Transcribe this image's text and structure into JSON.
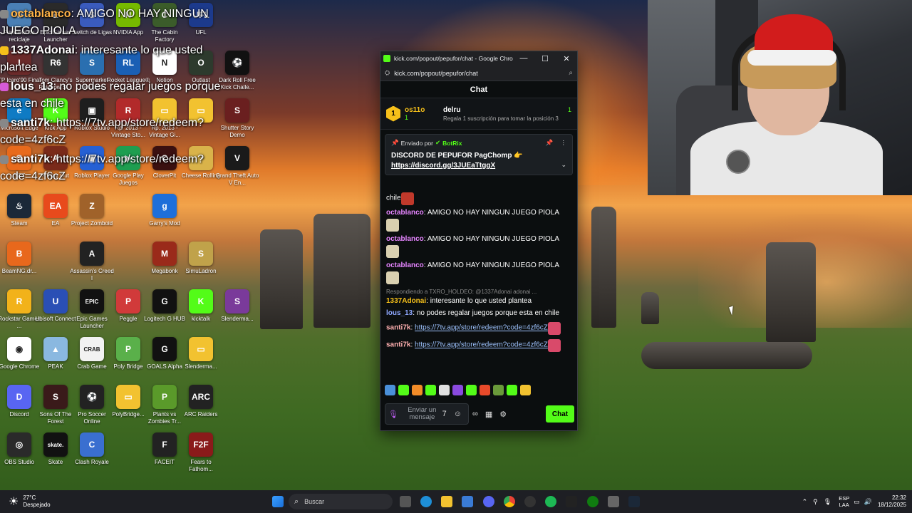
{
  "desktop": {
    "icons": [
      {
        "label": "Papelera de reciclaje",
        "color": "#4a7fb5",
        "glyph": "♻",
        "col": 0,
        "row": 0
      },
      {
        "label": "Epic Games Launcher",
        "color": "#2a2a2a",
        "glyph": "E",
        "col": 1,
        "row": 0
      },
      {
        "label": "Switch de Ligas",
        "color": "#3a5bbd",
        "glyph": "S",
        "col": 2,
        "row": 0
      },
      {
        "label": "NVIDIA App",
        "color": "#76b900",
        "glyph": "N",
        "col": 3,
        "row": 0
      },
      {
        "label": "The Cabin Factory",
        "color": "#3b5c2a",
        "glyph": "C",
        "col": 4,
        "row": 0
      },
      {
        "label": "UFL",
        "color": "#1c3a8c",
        "glyph": "UFL",
        "col": 5,
        "row": 0
      },
      {
        "label": "TP Icaro'90 Final",
        "color": "#6b2a2a",
        "glyph": "I",
        "col": 0,
        "row": 1
      },
      {
        "label": "Tom Clancy's Rainbow Si...",
        "color": "#333",
        "glyph": "R6",
        "col": 1,
        "row": 1
      },
      {
        "label": "Supermarket Simulator",
        "color": "#2a6fb0",
        "glyph": "S",
        "col": 2,
        "row": 1
      },
      {
        "label": "Rocket League®",
        "color": "#1a5fb4",
        "glyph": "RL",
        "col": 3,
        "row": 1
      },
      {
        "label": "Notion",
        "color": "#ffffff",
        "glyph": "N",
        "col": 4,
        "row": 1
      },
      {
        "label": "Outlast",
        "color": "#2d3a2d",
        "glyph": "O",
        "col": 5,
        "row": 1
      },
      {
        "label": "Dark Roll Free Kick Challe...",
        "color": "#111",
        "glyph": "⚽",
        "col": 6,
        "row": 1
      },
      {
        "label": "Microsoft Edge",
        "color": "#0f7bc4",
        "glyph": "e",
        "col": 0,
        "row": 2
      },
      {
        "label": "Kick App",
        "color": "#53fc18",
        "glyph": "K",
        "col": 1,
        "row": 2
      },
      {
        "label": "Roblox Studio",
        "color": "#1e1e1e",
        "glyph": "▣",
        "col": 2,
        "row": 2
      },
      {
        "label": "Rp. 2013 - Vintage Sto...",
        "color": "#b22a2a",
        "glyph": "R",
        "col": 3,
        "row": 2
      },
      {
        "label": "Rp. 2013 - Vintage Gi...",
        "color": "#f2c230",
        "glyph": "▭",
        "col": 4,
        "row": 2
      },
      {
        "label": "",
        "color": "#f2c230",
        "glyph": "▭",
        "col": 5,
        "row": 2
      },
      {
        "label": "Shutter Story Demo",
        "color": "#6a1f1f",
        "glyph": "S",
        "col": 6,
        "row": 2
      },
      {
        "label": "GCC",
        "color": "#e86a1c",
        "glyph": "G",
        "col": 0,
        "row": 3
      },
      {
        "label": "A Way Out",
        "color": "#7a2a1a",
        "glyph": "A",
        "col": 1,
        "row": 3
      },
      {
        "label": "Roblox Player",
        "color": "#2560d4",
        "glyph": "▣",
        "col": 2,
        "row": 3
      },
      {
        "label": "Google Play Juegos",
        "color": "#1e9e50",
        "glyph": "▶",
        "col": 3,
        "row": 3
      },
      {
        "label": "CloverPit",
        "color": "#3a1010",
        "glyph": "C",
        "col": 4,
        "row": 3
      },
      {
        "label": "Cheese Rolling",
        "color": "#d9b34a",
        "glyph": "◔",
        "col": 5,
        "row": 3
      },
      {
        "label": "Grand Theft Auto V En...",
        "color": "#1a1a1a",
        "glyph": "V",
        "col": 6,
        "row": 3
      },
      {
        "label": "Steam",
        "color": "#1b2838",
        "glyph": "♨",
        "col": 0,
        "row": 4
      },
      {
        "label": "EA",
        "color": "#e84a1c",
        "glyph": "EA",
        "col": 1,
        "row": 4
      },
      {
        "label": "Project Zomboid",
        "color": "#a0622a",
        "glyph": "Z",
        "col": 2,
        "row": 4
      },
      {
        "label": "Garry's Mod",
        "color": "#1e6fd9",
        "glyph": "g",
        "col": 4,
        "row": 4
      },
      {
        "label": "BeamNG.dr...",
        "color": "#e8681c",
        "glyph": "B",
        "col": 0,
        "row": 5
      },
      {
        "label": "Assassin's Creed I",
        "color": "#222",
        "glyph": "A",
        "col": 2,
        "row": 5
      },
      {
        "label": "Megabonk",
        "color": "#9a2a1a",
        "glyph": "M",
        "col": 4,
        "row": 5
      },
      {
        "label": "SimuLadron",
        "color": "#c0a24a",
        "glyph": "S",
        "col": 5,
        "row": 5
      },
      {
        "label": "Rockstar Games ...",
        "color": "#f2b21a",
        "glyph": "R",
        "col": 0,
        "row": 6
      },
      {
        "label": "Ubisoft Connect",
        "color": "#2a4fb5",
        "glyph": "U",
        "col": 1,
        "row": 6
      },
      {
        "label": "Epic Games Launcher",
        "color": "#111",
        "glyph": "EPIC",
        "col": 2,
        "row": 6
      },
      {
        "label": "Peggle",
        "color": "#d13a3a",
        "glyph": "P",
        "col": 3,
        "row": 6
      },
      {
        "label": "Logitech G HUB",
        "color": "#111",
        "glyph": "G",
        "col": 4,
        "row": 6
      },
      {
        "label": "kicktalk",
        "color": "#53fc18",
        "glyph": "K",
        "col": 5,
        "row": 6
      },
      {
        "label": "Slenderma...",
        "color": "#7a3a9a",
        "glyph": "S",
        "col": 6,
        "row": 6
      },
      {
        "label": "Google Chrome",
        "color": "#ffffff",
        "glyph": "◉",
        "col": 0,
        "row": 7
      },
      {
        "label": "PEAK",
        "color": "#8ab8e0",
        "glyph": "▲",
        "col": 1,
        "row": 7
      },
      {
        "label": "Crab Game",
        "color": "#f2f2f2",
        "glyph": "CRAB",
        "col": 2,
        "row": 7
      },
      {
        "label": "Poly Bridge",
        "color": "#5ab04a",
        "glyph": "P",
        "col": 3,
        "row": 7
      },
      {
        "label": "GOALS Alpha",
        "color": "#111",
        "glyph": "G",
        "col": 4,
        "row": 7
      },
      {
        "label": "Slenderma...",
        "color": "#f2c230",
        "glyph": "▭",
        "col": 5,
        "row": 7
      },
      {
        "label": "Discord",
        "color": "#5865f2",
        "glyph": "D",
        "col": 0,
        "row": 8
      },
      {
        "label": "Sons Of The Forest",
        "color": "#3a1a1a",
        "glyph": "S",
        "col": 1,
        "row": 8
      },
      {
        "label": "Pro Soccer Online",
        "color": "#222",
        "glyph": "⚽",
        "col": 2,
        "row": 8
      },
      {
        "label": "PolyBridge...",
        "color": "#f2c230",
        "glyph": "▭",
        "col": 3,
        "row": 8
      },
      {
        "label": "Plants vs Zombies Tr...",
        "color": "#5a9a2a",
        "glyph": "P",
        "col": 4,
        "row": 8
      },
      {
        "label": "ARC Raiders",
        "color": "#222",
        "glyph": "ARC",
        "col": 5,
        "row": 8
      },
      {
        "label": "OBS Studio",
        "color": "#2a2a2a",
        "glyph": "◎",
        "col": 0,
        "row": 9
      },
      {
        "label": "Skate",
        "color": "#111",
        "glyph": "skate.",
        "col": 1,
        "row": 9
      },
      {
        "label": "Clash Royale",
        "color": "#3a6fd0",
        "glyph": "C",
        "col": 2,
        "row": 9
      },
      {
        "label": "FACEIT",
        "color": "#222",
        "glyph": "F",
        "col": 4,
        "row": 9
      },
      {
        "label": "Fears to Fathom...",
        "color": "#8a1a1a",
        "glyph": "F2F",
        "col": 5,
        "row": 9
      }
    ]
  },
  "overlay_chat": [
    {
      "user": "octablanco",
      "sep": ":",
      "text": " AMIGO NO HAY NINGUN JUEGO PIOLA",
      "badge": "#888"
    },
    {
      "user": "1337Adonai",
      "sep": ":",
      "text": " interesante lo que usted plantea",
      "badge": "#f6c01a"
    },
    {
      "user": "lous_13",
      "sep": ":",
      "text": " no podes regalar juegos porque esta en chile",
      "badge": "#d65ad6"
    },
    {
      "user": "santi7k",
      "sep": ":",
      "text": " https://7tv.app/store/redeem?code=4zf6cZ",
      "badge": "#888"
    },
    {
      "user": "santi7k",
      "sep": ":",
      "text": " https://7tv.app/store/redeem?code=4zf6cZ",
      "badge": "#888"
    }
  ],
  "window": {
    "title": "kick.com/popout/pepufor/chat - Google Chro...",
    "url": "kick.com/popout/pepufor/chat",
    "minimize": "—",
    "maximize": "☐",
    "close": "✕",
    "chat_header": "Chat",
    "gifters": {
      "rank": "1",
      "top_user": "os11o",
      "top_count": "1",
      "second_user": "delru",
      "second_count": "1",
      "promo": "Regala 1 suscripción para tomar la posición 3"
    },
    "pinned": {
      "sent_by_label": "Enviado por",
      "sent_by_user": "BotRix",
      "message": "DISCORD DE PEPUFOR PagChomp 👉",
      "link": "https://discord.gg/3JUEaTtggX"
    },
    "messages": [
      {
        "user": "",
        "text": "chile",
        "color": "#fff",
        "emote": "#c0392b"
      },
      {
        "user": "octablanco",
        "text": "AMIGO NO HAY NINGUN JUEGO PIOLA",
        "color": "#e685ff",
        "emote": "#d9d0b0"
      },
      {
        "user": "octablanco",
        "text": "AMIGO NO HAY NINGUN JUEGO PIOLA",
        "color": "#e685ff",
        "emote": "#d9d0b0"
      },
      {
        "user": "octablanco",
        "text": "AMIGO NO HAY NINGUN JUEGO PIOLA",
        "color": "#e685ff",
        "emote": "#d9d0b0"
      }
    ],
    "reply": {
      "context": "Respondiendo a TXRO_HOLDEO: @1337Adonai adonai ...",
      "user": "1337Adonai",
      "text": "interesante lo que usted plantea",
      "color": "#f6c01a"
    },
    "lous": {
      "user": "lous_13",
      "text": "no podes regalar juegos porque esta en chile",
      "color": "#8fa8ff"
    },
    "santi": [
      {
        "user": "santi7k",
        "link": "https://7tv.app/store/redeem?code=4zf6cZ",
        "color": "#ffb0b0"
      },
      {
        "user": "santi7k",
        "link": "https://7tv.app/store/redeem?code=4zf6cZ",
        "color": "#ffb0b0"
      }
    ],
    "input_placeholder": "Enviar un mensaje",
    "chat_button": "Chat",
    "emote_colors": [
      "#4a90d9",
      "#53fc18",
      "#f28c28",
      "#53fc18",
      "#e0e0e0",
      "#8a4adf",
      "#53fc18",
      "#e84a2a",
      "#6a9a3a",
      "#53fc18",
      "#f2c230"
    ]
  },
  "taskbar": {
    "temp": "27°C",
    "weather": "Despejado",
    "search_placeholder": "Buscar",
    "lang_top": "ESP",
    "lang_bottom": "LAA",
    "time": "22:32",
    "date": "18/12/2025"
  }
}
